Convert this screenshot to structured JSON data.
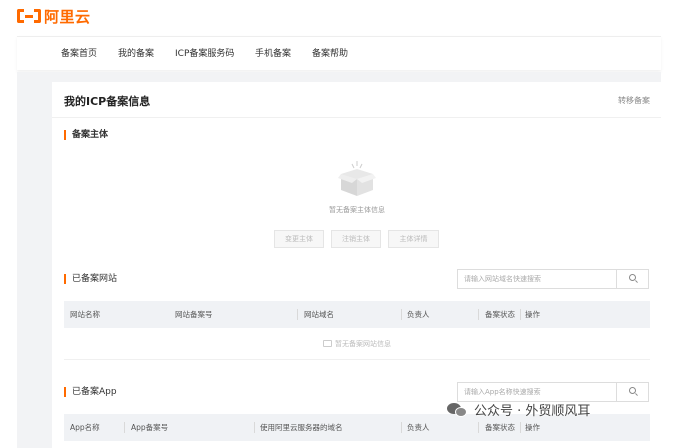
{
  "brand": {
    "name": "阿里云",
    "accent": "#ff6a00"
  },
  "nav": {
    "items": [
      "备案首页",
      "我的备案",
      "ICP备案服务码",
      "手机备案",
      "备案帮助"
    ]
  },
  "page": {
    "title": "我的ICP备案信息",
    "transfer_link": "转移备案"
  },
  "subject": {
    "title": "备案主体",
    "empty_text": "暂无备案主体信息",
    "buttons": [
      "变更主体",
      "注销主体",
      "主体详情"
    ]
  },
  "websites": {
    "title": "已备案网站",
    "search_placeholder": "请输入网站域名快速搜索",
    "columns": [
      "网站名称",
      "网站备案号",
      "网站域名",
      "负责人",
      "备案状态",
      "操作"
    ],
    "empty_text": "暂无备案网站信息"
  },
  "apps": {
    "title": "已备案App",
    "search_placeholder": "请输入App名称快速搜索",
    "columns": [
      "App名称",
      "App备案号",
      "使用阿里云服务器的域名",
      "负责人",
      "备案状态",
      "操作"
    ]
  },
  "watermark": {
    "text": "公众号 · 外贸顺风耳"
  },
  "icons": [
    "search-icon",
    "empty-box-icon",
    "wechat-icon"
  ]
}
